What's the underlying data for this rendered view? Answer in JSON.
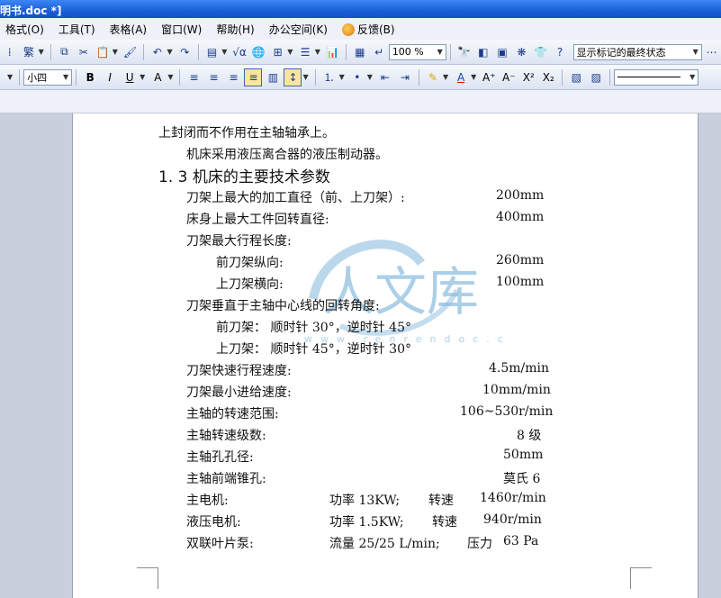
{
  "window": {
    "title": "明书.doc *]"
  },
  "menu": [
    {
      "label": "格式(O)"
    },
    {
      "label": "工具(T)"
    },
    {
      "label": "表格(A)"
    },
    {
      "label": "窗口(W)"
    },
    {
      "label": "帮助(H)"
    },
    {
      "label": "办公空间(K)"
    },
    {
      "label": "反馈(B)",
      "icon": "feedback-icon"
    }
  ],
  "toolbar1": {
    "zoom": "100 %",
    "markup_view": "显示标记的最终状态"
  },
  "toolbar2": {
    "font_size": "小四"
  },
  "document": {
    "lines": [
      {
        "text": "上封闭而不作用在主轴轴承上。"
      },
      {
        "text": "机床采用液压离合器的液压制动器。"
      },
      {
        "text": "1. 3 机床的主要技术参数"
      },
      {
        "text": "刀架上最大的加工直径（前、上刀架）:",
        "value": "200mm"
      },
      {
        "text": "床身上最大工件回转直径:",
        "value": "400mm"
      },
      {
        "text": "刀架最大行程长度:"
      },
      {
        "text": "前刀架纵向:",
        "value": "260mm"
      },
      {
        "text": "上刀架横向:",
        "value": "100mm"
      },
      {
        "text": "刀架垂直于主轴中心线的回转角度:"
      },
      {
        "text": "前刀架：  顺时针 30°，逆时针 45°"
      },
      {
        "text": "上刀架：  顺时针 45°，逆时针 30°"
      },
      {
        "text": "刀架快速行程速度:",
        "value": "4.5m/min"
      },
      {
        "text": "刀架最小进给速度:",
        "value": "10mm/min"
      },
      {
        "text": "主轴的转速范围:",
        "value": "106~530r/min"
      },
      {
        "text": "主轴转速级数:",
        "value": "8 级"
      },
      {
        "text": "主轴孔孔径:",
        "value": "50mm"
      },
      {
        "text": "主轴前端锥孔:",
        "value": "莫氏 6"
      },
      {
        "text": "主电机:",
        "mid": "功率 13KW;",
        "mid2": "转速",
        "value": "1460r/min"
      },
      {
        "text": "液压电机:",
        "mid": "功率 1.5KW;",
        "mid2": "转速",
        "value": "940r/min"
      },
      {
        "text": "双联叶片泵:",
        "mid": "流量 25/25 L/min;",
        "mid2": "压力",
        "value": "63 Pa"
      }
    ]
  },
  "watermark": {
    "text": "人文库",
    "url_text": "www.renrendoc.com"
  },
  "colors": {
    "titlebar": "#1a5fd8",
    "toolbar": "#e6ebf5",
    "page": "#ffffff",
    "watermark": "#7fb6dc"
  }
}
